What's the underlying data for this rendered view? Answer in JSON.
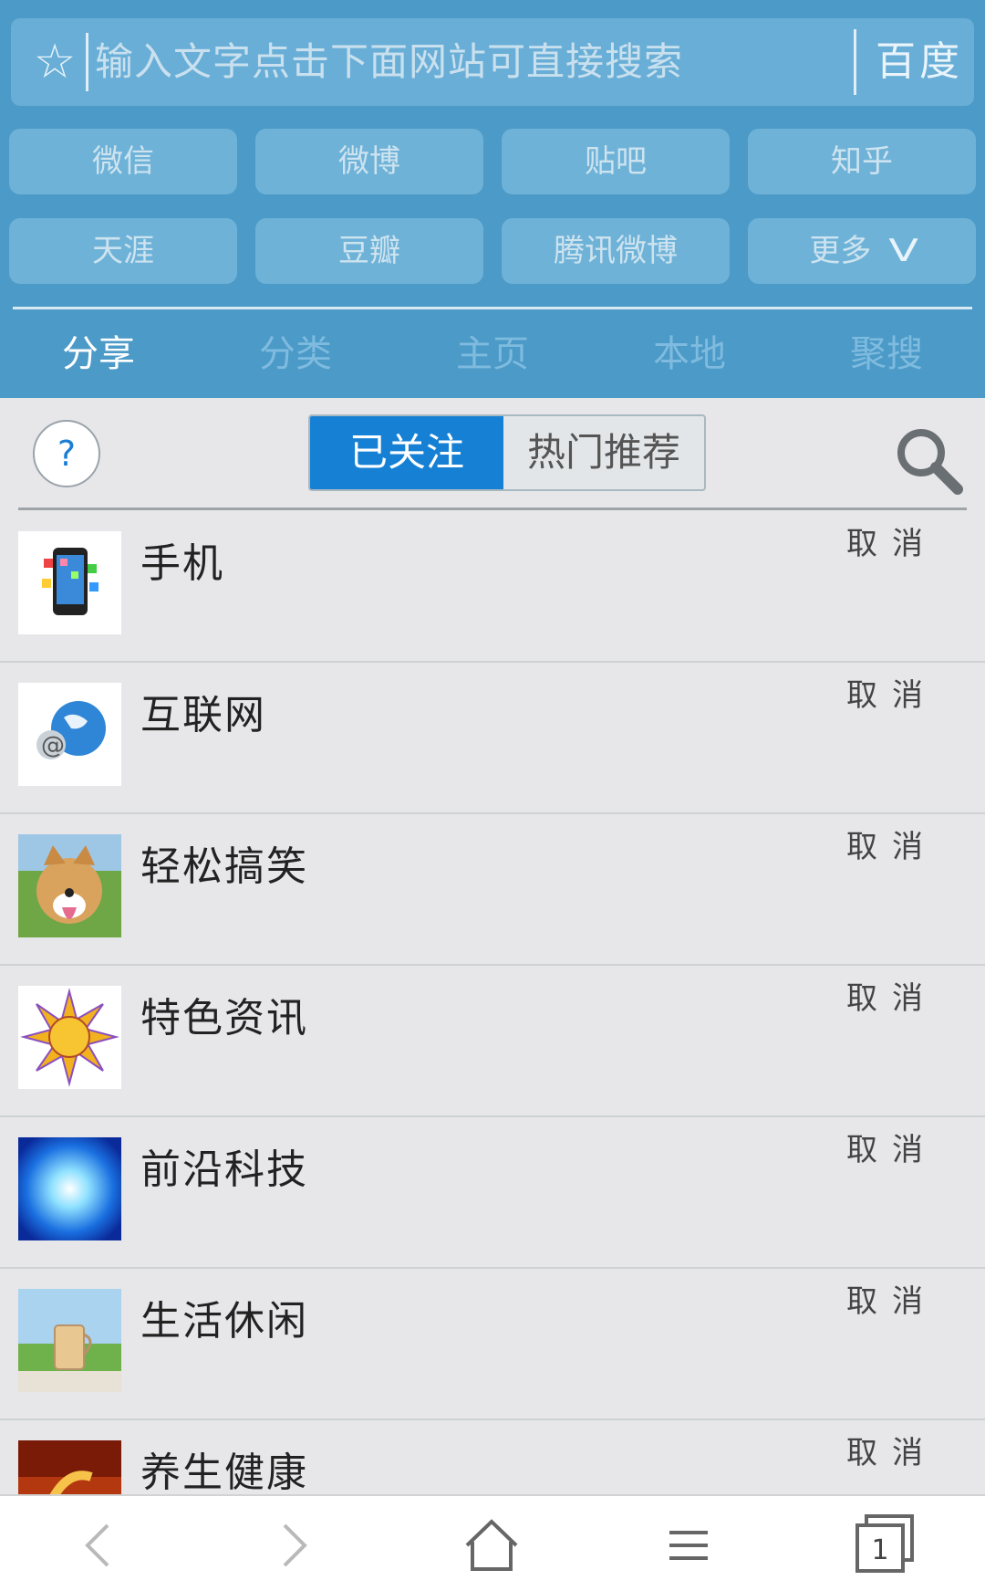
{
  "search": {
    "placeholder": "输入文字点击下面网站可直接搜索",
    "engine": "百度",
    "star_icon": "star-icon"
  },
  "quick_links": [
    "微信",
    "微博",
    "贴吧",
    "知乎",
    "天涯",
    "豆瓣",
    "腾讯微博",
    "更多"
  ],
  "nav_tabs": [
    "分享",
    "分类",
    "主页",
    "本地",
    "聚搜"
  ],
  "active_tab": "分享",
  "toolbar": {
    "help_label": "?",
    "segment_followed": "已关注",
    "segment_hot": "热门推荐"
  },
  "list": [
    {
      "title": "手机",
      "cancel": "取消",
      "icon": "phone-thumbnail"
    },
    {
      "title": "互联网",
      "cancel": "取消",
      "icon": "globe-email-thumbnail"
    },
    {
      "title": "轻松搞笑",
      "cancel": "取消",
      "icon": "laughing-dog-thumbnail"
    },
    {
      "title": "特色资讯",
      "cancel": "取消",
      "icon": "sun-face-thumbnail"
    },
    {
      "title": "前沿科技",
      "cancel": "取消",
      "icon": "blue-energy-thumbnail"
    },
    {
      "title": "生活休闲",
      "cancel": "取消",
      "icon": "tea-glass-thumbnail"
    },
    {
      "title": "养生健康",
      "cancel": "取消",
      "icon": "health-calligraphy-thumbnail"
    }
  ],
  "bottom_bar": {
    "tab_count": "1",
    "icons": [
      "back-icon",
      "forward-icon",
      "home-icon",
      "menu-icon",
      "tabs-icon"
    ]
  },
  "colors": {
    "header_bg": "#4b9ac7",
    "active_segment": "#1681d4",
    "page_bg": "#e7e7e9"
  }
}
